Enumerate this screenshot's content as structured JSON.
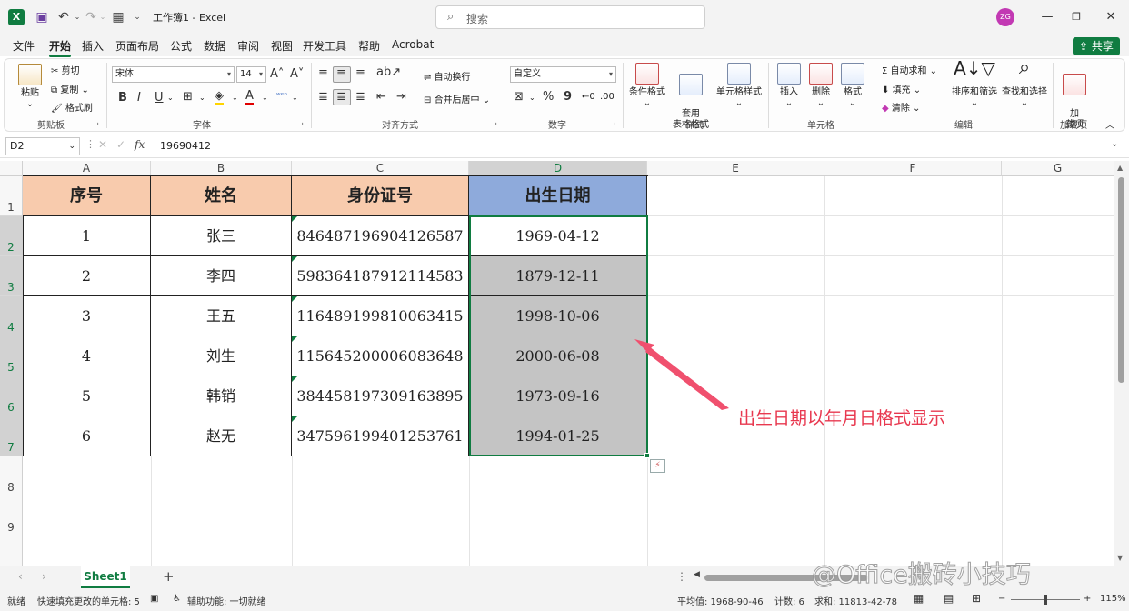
{
  "titlebar": {
    "doc_title": "工作簿1 - Excel",
    "search_placeholder": "搜索",
    "user_initials": "ZG",
    "quick_access": [
      "保存",
      "撤消",
      "恢复",
      "表单",
      "自定义"
    ]
  },
  "menu": {
    "items": [
      "文件",
      "开始",
      "插入",
      "页面布局",
      "公式",
      "数据",
      "审阅",
      "视图",
      "开发工具",
      "帮助",
      "Acrobat"
    ],
    "active": "开始",
    "share_label": "共享"
  },
  "ribbon": {
    "clipboard": {
      "paste": "粘贴",
      "cut": "剪切",
      "copy": "复制",
      "format_painter": "格式刷",
      "label": "剪贴板"
    },
    "font": {
      "name": "宋体",
      "size": "14",
      "label": "字体",
      "bold": "B",
      "italic": "I",
      "underline": "U"
    },
    "alignment": {
      "wrap": "自动换行",
      "merge": "合并后居中",
      "label": "对齐方式"
    },
    "number": {
      "format": "自定义",
      "label": "数字"
    },
    "styles": {
      "conditional": "条件格式",
      "table_style": "套用\n表格格式",
      "cell_style": "单元格样式",
      "label": "样式"
    },
    "cells": {
      "insert": "插入",
      "delete": "删除",
      "format": "格式",
      "label": "单元格"
    },
    "editing": {
      "autosum": "自动求和",
      "fill": "填充",
      "clear": "清除",
      "sort": "排序和筛选",
      "find": "查找和选择",
      "label": "编辑"
    },
    "addins": {
      "addin": "加\n载项",
      "label": "加载项"
    }
  },
  "formula_bar": {
    "name_box": "D2",
    "fx": "fx",
    "value": "19690412"
  },
  "columns": [
    "A",
    "B",
    "C",
    "D",
    "E",
    "F",
    "G"
  ],
  "rows": [
    "1",
    "2",
    "3",
    "4",
    "5",
    "6",
    "7",
    "8",
    "9"
  ],
  "table": {
    "headers": [
      "序号",
      "姓名",
      "身份证号",
      "出生日期"
    ],
    "rows": [
      [
        "1",
        "张三",
        "846487196904126587",
        "1969-04-12"
      ],
      [
        "2",
        "李四",
        "598364187912114583",
        "1879-12-11"
      ],
      [
        "3",
        "王五",
        "116489199810063415",
        "1998-10-06"
      ],
      [
        "4",
        "刘生",
        "115645200006083648",
        "2000-06-08"
      ],
      [
        "5",
        "韩销",
        "384458197309163895",
        "1973-09-16"
      ],
      [
        "6",
        "赵无",
        "347596199401253761",
        "1994-01-25"
      ]
    ]
  },
  "annotation": "出生日期以年月日格式显示",
  "sheets": {
    "tabs": [
      "Sheet1"
    ],
    "add": "+"
  },
  "watermark": "@Office搬砖小技巧",
  "status": {
    "ready": "就绪",
    "fill_msg": "快速填充更改的单元格: 5",
    "accessibility": "辅助功能: 一切就绪",
    "average": "平均值: 1968-90-46",
    "count": "计数: 6",
    "sum": "求和: 11813-42-78",
    "zoom": "115%"
  },
  "colors": {
    "accent": "#107c41",
    "header_peach": "#f8cbad",
    "header_blue": "#8eaadb",
    "selection_gray": "#c4c4c4",
    "annotation": "#e8384f"
  }
}
